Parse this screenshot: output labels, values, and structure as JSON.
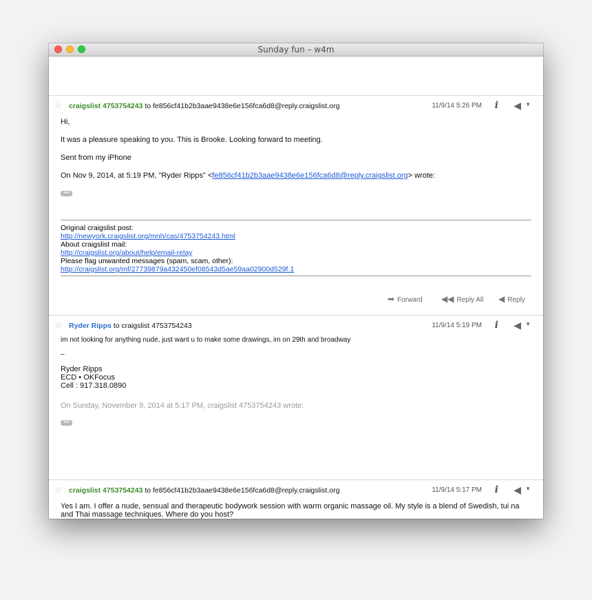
{
  "window": {
    "title": "Sunday fun – w4m"
  },
  "messages": [
    {
      "from_name": "craigslist 4753754243",
      "to_text": "to fe856cf41b2b3aae9438e6e156fca6d8@reply.craigslist.org",
      "date": "11/9/14 5:26 PM",
      "lines": [
        "Hi,",
        "It was a pleasure speaking to you. This is Brooke. Looking forward to meeting.",
        "Sent from my iPhone"
      ],
      "quote_prefix": "On Nov 9, 2014, at 5:19 PM, \"Ryder Ripps\" <",
      "quote_link": "fe856cf41b2b3aae9438e6e156fca6d8@reply.craigslist.org",
      "quote_suffix": "> wrote:",
      "ellipsis": "•••",
      "footer": {
        "label1": "Original craigslist post:",
        "link1": "http://newyork.craigslist.org/mnh/cas/4753754243.html",
        "label2": "About craigslist mail:",
        "link2": "http://craigslist.org/about/help/email-relay",
        "label3": "Please flag unwanted messages (spam, scam, other):",
        "link3": "http://craigslist.org/mf/27739879a432450ef08543d5ae59aa02900d529f.1"
      },
      "actions": {
        "forward": "Forward",
        "reply_all": "Reply All",
        "reply": "Reply"
      }
    },
    {
      "from_name": "Ryder Ripps",
      "to_text": "to craigslist 4753754243",
      "date": "11/9/14 5:19 PM",
      "line1": "im not looking for anything nude, just want u to make some drawings, im on 29th and broadway",
      "sig_dash": "–",
      "sig_name": "Ryder Ripps",
      "sig_title": "ECD • OKFocus",
      "sig_cell": "Cell : 917.318.0890",
      "quote": "On Sunday, November 9, 2014 at 5:17 PM, craigslist 4753754243 wrote:",
      "ellipsis": "•••"
    },
    {
      "from_name": "craigslist 4753754243",
      "to_text": "to fe856cf41b2b3aae9438e6e156fca6d8@reply.craigslist.org",
      "date": "11/9/14 5:17 PM",
      "body": "Yes I am. I offer a nude, sensual and therapeutic bodywork session with warm organic massage oil. My style is a blend of Swedish, tui na and Thai massage techniques. Where do you host?"
    }
  ],
  "icons": {
    "star": "☆",
    "info": "i",
    "reply": "◀",
    "chevron": "▼",
    "forward": "➡",
    "reply_all": "◀◀",
    "reply_small": "◀"
  },
  "colors": {
    "sender_green": "#3b8c2a",
    "sender_blue": "#2b6fcf",
    "link": "#1d5ad7"
  }
}
